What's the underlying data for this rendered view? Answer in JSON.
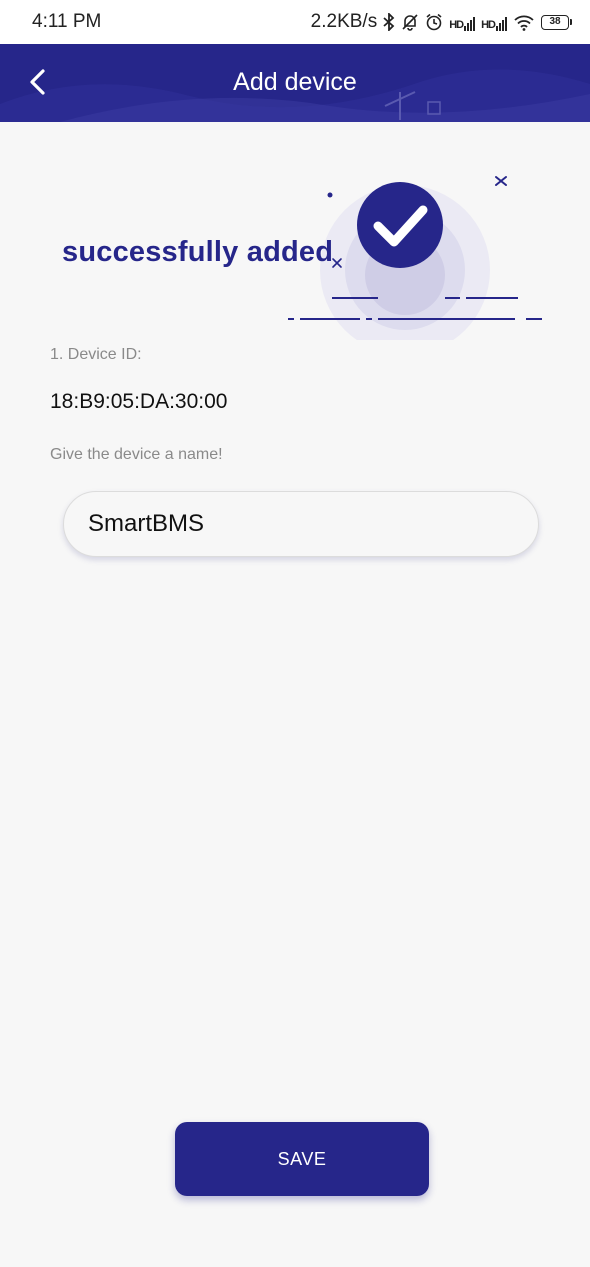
{
  "status_bar": {
    "time": "4:11 PM",
    "net_speed": "2.2KB/s",
    "signal_label": "HD",
    "battery": "38",
    "icons": [
      "bluetooth-icon",
      "mute-bell-icon",
      "alarm-icon",
      "signal-icon",
      "signal-icon",
      "wifi-icon",
      "battery-icon"
    ]
  },
  "header": {
    "title": "Add device",
    "background": "#26268a",
    "icons": [
      "back-chevron-icon"
    ]
  },
  "hero": {
    "message": "successfully added",
    "icons": [
      "check-circle-icon"
    ],
    "accent": "#26268a"
  },
  "form": {
    "device_id_label": "1. Device ID:",
    "device_id_value": "18:B9:05:DA:30:00",
    "name_prompt": "Give the device a name!",
    "name_value": "SmartBMS"
  },
  "actions": {
    "save_label": "SAVE"
  }
}
